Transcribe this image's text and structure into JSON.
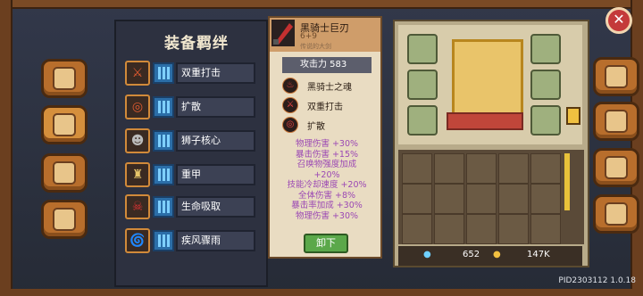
{
  "left_panel": {
    "title": "装备羁绊",
    "items": [
      {
        "label": "双重打击",
        "icon": "double-strike-icon"
      },
      {
        "label": "扩散",
        "icon": "spread-icon"
      },
      {
        "label": "狮子核心",
        "icon": "lion-core-icon"
      },
      {
        "label": "重甲",
        "icon": "heavy-armor-icon"
      },
      {
        "label": "生命吸取",
        "icon": "life-drain-icon"
      },
      {
        "label": "疾风骤雨",
        "icon": "storm-icon"
      }
    ]
  },
  "tooltip": {
    "item_name": "黑骑士巨刃",
    "upgrade": "6+9",
    "subtitle": "传说的大剑",
    "attack_label": "攻击力 583",
    "perks": [
      "黑骑士之魂",
      "双重打击",
      "扩散"
    ],
    "stats": [
      "物理伤害 +30%",
      "暴击伤害 +15%",
      "召唤物强度加成",
      "+20%",
      "技能冷却速度 +20%",
      "全体伤害 +8%",
      "暴击率加成 +30%",
      "物理伤害 +30%"
    ],
    "unequip_label": "卸下"
  },
  "inventory": {
    "gold": "652",
    "gems": "147K"
  },
  "version": "PID2303112 1.0.18",
  "colors": {
    "accent": "#d58f3c",
    "stat_text": "#9b48b4",
    "close": "#c43a3a"
  }
}
